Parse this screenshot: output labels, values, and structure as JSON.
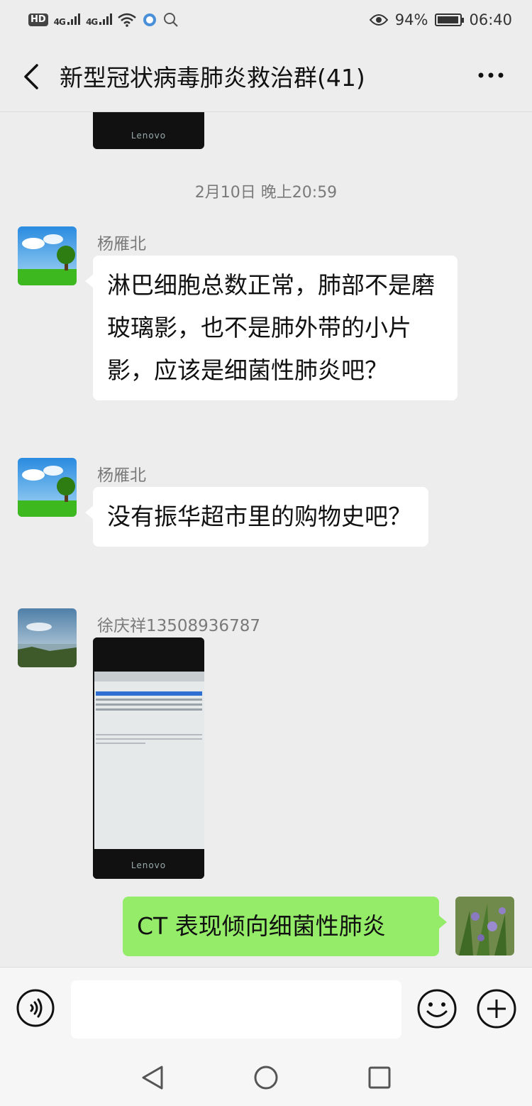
{
  "status_bar": {
    "hd_label": "HD",
    "signal1_label": "4G",
    "signal2_label": "4G",
    "battery_percent": "94%",
    "battery_level": 0.94,
    "time": "06:40"
  },
  "header": {
    "title": "新型冠状病毒肺炎救治群(41)"
  },
  "chat": {
    "top_image_brand": "Lenovo",
    "timestamp": "2月10日 晚上20:59",
    "messages": [
      {
        "sender": "杨雁北",
        "text": "淋巴细胞总数正常，肺部不是磨玻璃影，也不是肺外带的小片影，应该是细菌性肺炎吧？"
      },
      {
        "sender": "杨雁北",
        "text": "没有振华超市里的购物史吧？"
      },
      {
        "sender": "徐庆祥13508936787",
        "image_brand": "Lenovo"
      },
      {
        "sender": "self",
        "text": "CT 表现倾向细菌性肺炎"
      }
    ]
  },
  "colors": {
    "background": "#ededed",
    "bubble_in": "#ffffff",
    "bubble_out": "#95ec69",
    "meta_text": "#7a7a7a"
  },
  "icons": {
    "back": "chevron-left-icon",
    "more": "more-dots-icon",
    "voice": "voice-icon",
    "emoji": "emoji-icon",
    "plus": "plus-icon",
    "nav_back": "triangle-back-icon",
    "nav_home": "circle-home-icon",
    "nav_recent": "square-recent-icon"
  }
}
